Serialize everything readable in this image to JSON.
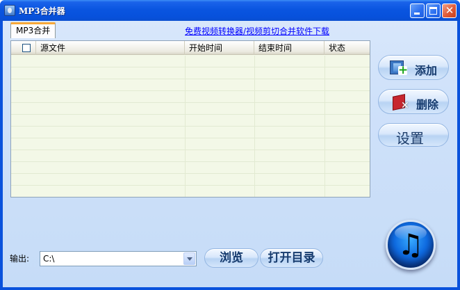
{
  "window": {
    "title": "MP3合并器"
  },
  "tabs": [
    {
      "label": "MP3合并"
    }
  ],
  "promo_link": "免费视频转换器/视频剪切合并软件下载",
  "table": {
    "columns": [
      "源文件",
      "开始时间",
      "结束时间",
      "状态"
    ],
    "rows": []
  },
  "actions": {
    "add_label": "添加",
    "delete_label": "删除",
    "settings_label": "设置"
  },
  "output": {
    "label": "输出:",
    "path": "C:\\",
    "browse_label": "浏览",
    "open_dir_label": "打开目录"
  },
  "icons": {
    "logo": "music-note-icon",
    "add": "film-add-icon",
    "delete": "delete-icon"
  },
  "colors": {
    "title_bar": "#0a55e0",
    "client_bg": "#cfe1fa",
    "table_bg": "#f3f8e7",
    "tab_accent": "#f8a837",
    "link": "#0000ff"
  }
}
